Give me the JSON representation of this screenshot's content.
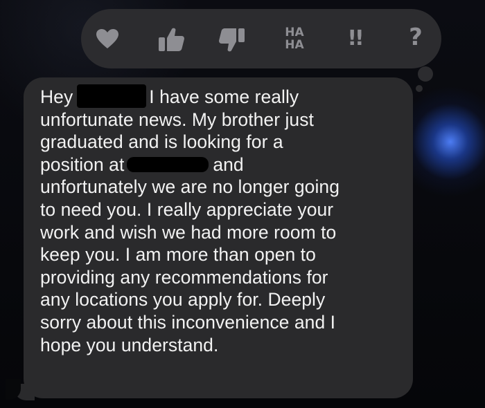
{
  "tapback": {
    "reactions": [
      {
        "icon": "heart-icon"
      },
      {
        "icon": "thumbs-up-icon"
      },
      {
        "icon": "thumbs-down-icon"
      },
      {
        "icon": "haha-icon",
        "line1": "HA",
        "line2": "HA"
      },
      {
        "icon": "emphasis-icon",
        "glyph": "!!"
      },
      {
        "icon": "question-icon",
        "glyph": "?"
      }
    ],
    "icon_color": "#8e8e93",
    "bar_color": "#2c2c2f"
  },
  "message": {
    "bubble_color": "#2a2a2c",
    "text_color": "#f2f2f2",
    "greeting": "Hey",
    "lines": [
      "I have some really",
      "unfortunate news. My brother just",
      "graduated and is looking for a",
      "position at",
      "and",
      "unfortunately we are no longer going",
      "to need you. I really appreciate your",
      "work and wish we had more room to",
      "keep you. I am more than open to",
      "providing any recommendations for",
      "any locations you apply for. Deeply",
      "sorry about this inconvenience and I",
      "hope you understand."
    ]
  }
}
